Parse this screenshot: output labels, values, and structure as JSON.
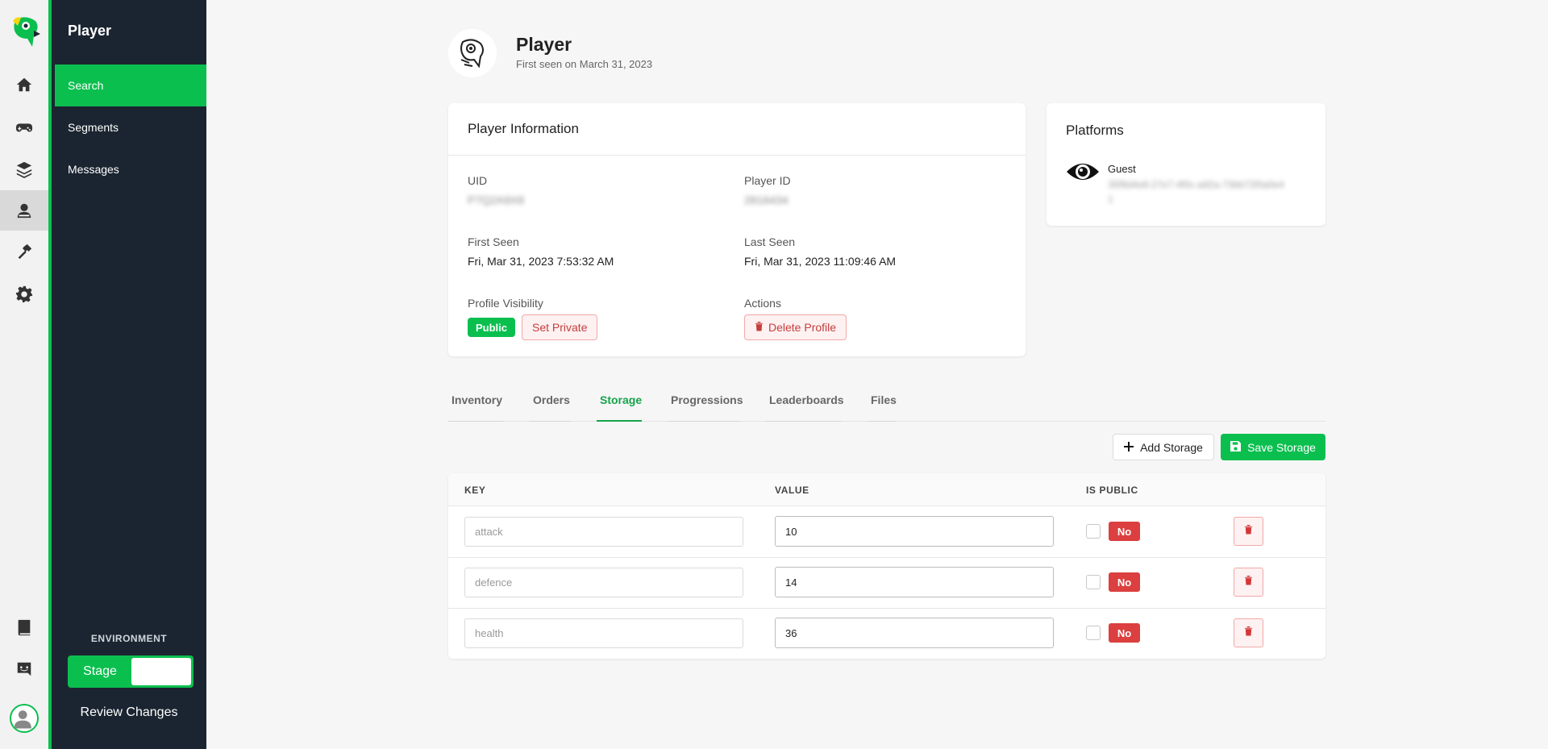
{
  "sidebar": {
    "title": "Player",
    "items": [
      {
        "label": "Search"
      },
      {
        "label": "Segments"
      },
      {
        "label": "Messages"
      }
    ],
    "environment_label": "ENVIRONMENT",
    "environment_value": "Stage",
    "review_label": "Review Changes"
  },
  "rail_icons": [
    "home-icon",
    "gamepad-icon",
    "layers-icon",
    "player-icon",
    "hammer-icon",
    "gear-icon",
    "book-icon",
    "discord-icon"
  ],
  "header": {
    "title": "Player",
    "subtitle": "First seen on March 31, 2023"
  },
  "player_info": {
    "title": "Player Information",
    "uid_label": "UID",
    "uid_value": "P7Q2A9X8",
    "player_id_label": "Player ID",
    "player_id_value": "2816434",
    "first_seen_label": "First Seen",
    "first_seen_value": "Fri, Mar 31, 2023 7:53:32 AM",
    "last_seen_label": "Last Seen",
    "last_seen_value": "Fri, Mar 31, 2023 11:09:46 AM",
    "visibility_label": "Profile Visibility",
    "visibility_badge": "Public",
    "set_private_label": "Set Private",
    "actions_label": "Actions",
    "delete_label": "Delete Profile"
  },
  "platforms": {
    "title": "Platforms",
    "name": "Guest",
    "id_line1": "35f9d4e8-27e7-4f0c-a92a-73bb72f0a0e4",
    "id_line2": "1"
  },
  "tabs": [
    {
      "label": "Inventory"
    },
    {
      "label": "Orders"
    },
    {
      "label": "Storage"
    },
    {
      "label": "Progressions"
    },
    {
      "label": "Leaderboards"
    },
    {
      "label": "Files"
    }
  ],
  "active_tab": "Storage",
  "toolbar": {
    "add_label": "Add Storage",
    "save_label": "Save Storage"
  },
  "table": {
    "headers": [
      "KEY",
      "VALUE",
      "IS PUBLIC"
    ],
    "rows": [
      {
        "key": "attack",
        "value": "10",
        "is_public": "No"
      },
      {
        "key": "defence",
        "value": "14",
        "is_public": "No"
      },
      {
        "key": "health",
        "value": "36",
        "is_public": "No"
      }
    ]
  },
  "colors": {
    "brand_green": "#0bbf4f",
    "sidebar_bg": "#1b2531",
    "danger_red": "#dc3f3f",
    "tab_active": "#16a34a"
  }
}
